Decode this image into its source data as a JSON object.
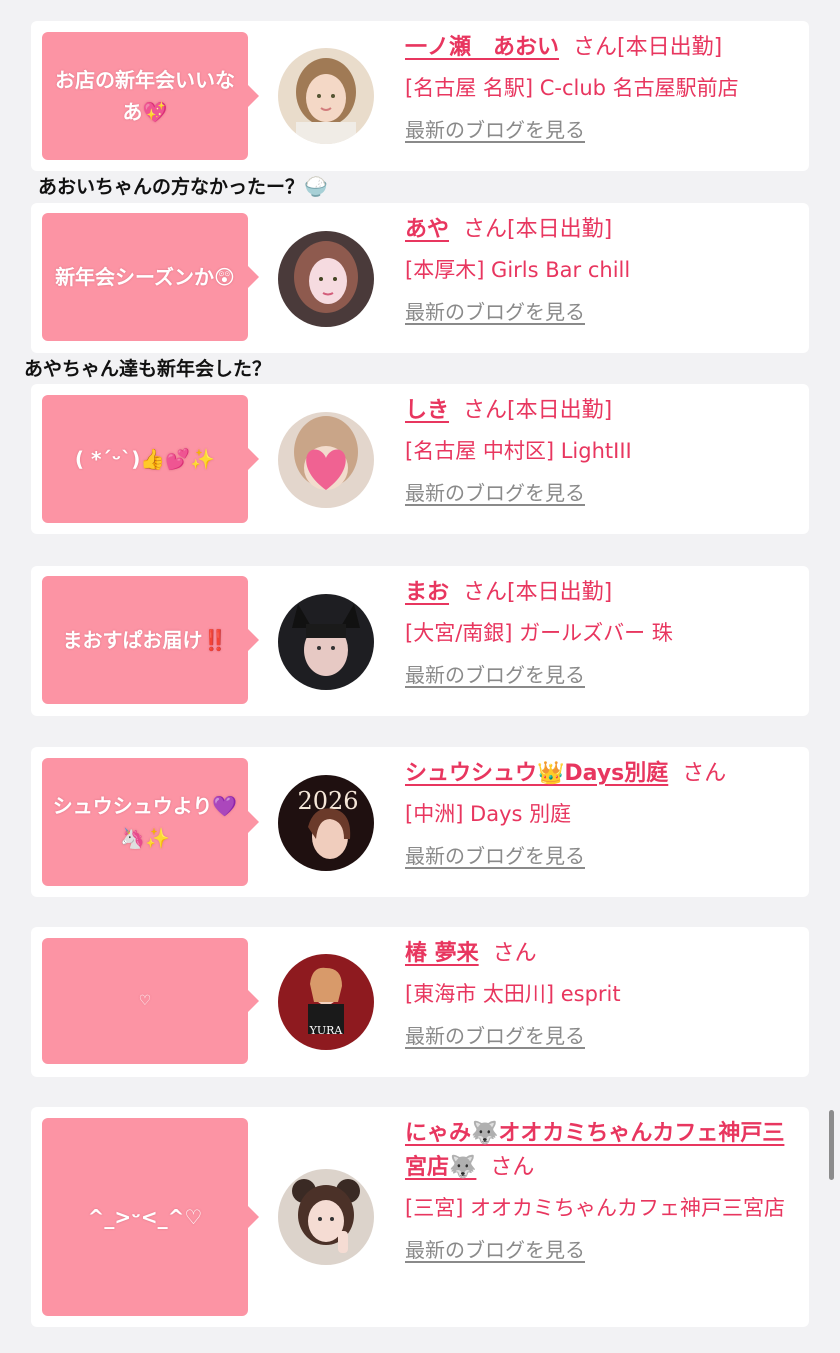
{
  "entries": [
    {
      "bubble": "お店の新年会いいなあ💖",
      "name": "一ノ瀬　あおい",
      "suffix": "さん",
      "status": "[本日出勤]",
      "shop": "[名古屋 名駅] C-club 名古屋駅前店",
      "blog_link": "最新のブログを見る",
      "comment": "あおいちゃんの方なかったー？🍚"
    },
    {
      "bubble": "新年会シーズンか😲",
      "name": "あや",
      "suffix": "さん",
      "status": "[本日出勤]",
      "shop": "[本厚木] Girls Bar chill",
      "blog_link": "最新のブログを見る",
      "comment": "あやちゃん達も新年会した？"
    },
    {
      "bubble": "( *ˊᵕˋ)👍💕✨",
      "name": "しき",
      "suffix": "さん",
      "status": "[本日出勤]",
      "shop": "[名古屋 中村区] LightIII",
      "blog_link": "最新のブログを見る"
    },
    {
      "bubble": "まおすぱお届け‼️",
      "name": "まお",
      "suffix": "さん",
      "status": "[本日出勤]",
      "shop": "[大宮/南銀] ガールズバー 珠",
      "blog_link": "最新のブログを見る"
    },
    {
      "bubble": "シュウシュウより💜🦄✨",
      "name": "シュウシュウ👑Days別庭",
      "suffix": "さん",
      "status": "",
      "shop": "[中洲] Days 別庭",
      "blog_link": "最新のブログを見る"
    },
    {
      "bubble": "♡",
      "name": "椿 夢来",
      "suffix": "さん",
      "status": "",
      "shop": "[東海市 太田川] esprit",
      "blog_link": "最新のブログを見る"
    },
    {
      "bubble": "^_>ᵕ<_^♡",
      "name": "にゃみ🐺オオカミちゃんカフェ神戸三宮店🐺",
      "suffix": "さん",
      "status": "",
      "shop": "[三宮] オオカミちゃんカフェ神戸三宮店",
      "blog_link": "最新のブログを見る"
    }
  ],
  "avatar_text": {
    "shushu": "2026",
    "yura": "YURA"
  },
  "colors": {
    "accent": "#e8365f",
    "bubble": "#fc94a4",
    "background": "#f2f2f4",
    "link_gray": "#8a8a8a"
  }
}
